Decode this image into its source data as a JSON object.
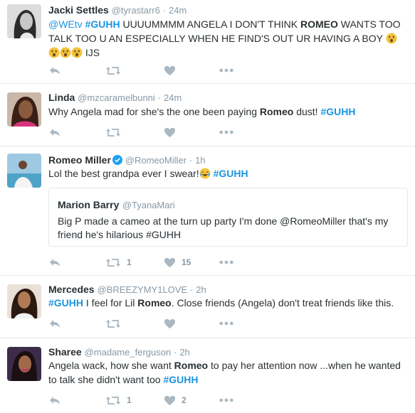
{
  "tweets": [
    {
      "name": "Jacki Settles",
      "handle": "@tyrastarr6",
      "separator": "·",
      "time": "24m",
      "text_parts": [
        "@WEtv",
        " ",
        "#GUHH",
        " UUUUMMMM ANGELA I DON'T THINK ",
        "ROMEO",
        " WANTS TOO TALK TOO U AN ESPECIALLY WHEN HE FIND'S OUT UR HAVING A BOY ",
        " IJS"
      ]
    },
    {
      "name": "Linda",
      "handle": "@mzcaramelbunni",
      "separator": "·",
      "time": "24m",
      "text_parts": [
        "Why Angela mad for she's the one been paying ",
        "Romeo",
        " dust! ",
        "#GUHH"
      ]
    },
    {
      "name": "Romeo Miller",
      "handle": "@RomeoMiller",
      "separator": "·",
      "time": "1h",
      "text_parts": [
        "Lol the best grandpa ever I swear!",
        " ",
        "#GUHH"
      ],
      "quote": {
        "name": "Marion Barry",
        "handle": "@TyanaMari",
        "text": "Big P made a cameo at the turn up party I'm done @RomeoMiller that's my friend he's hilarious #GUHH"
      },
      "retweet_count": "1",
      "like_count": "15"
    },
    {
      "name": "Mercedes",
      "handle": "@BREEZYMY1LOVE",
      "separator": "·",
      "time": "2h",
      "text_parts": [
        "#GUHH",
        " I feel for Lil ",
        "Romeo",
        ". Close friends (Angela) don't treat friends like this."
      ]
    },
    {
      "name": "Sharee",
      "handle": "@madame_ferguson",
      "separator": "·",
      "time": "2h",
      "text_parts": [
        "Angela wack, how she want ",
        "Romeo",
        " to pay her attention now ...when he wanted to talk she didn't want too ",
        "#GUHH"
      ],
      "retweet_count": "1",
      "like_count": "2"
    }
  ],
  "colors": {
    "link": "#1b95e0",
    "icon": "#aab8c2",
    "meta": "#8899a6",
    "border": "#e1e8ed"
  },
  "icons": [
    "reply-icon",
    "retweet-icon",
    "like-icon",
    "more-icon",
    "verified-icon"
  ]
}
